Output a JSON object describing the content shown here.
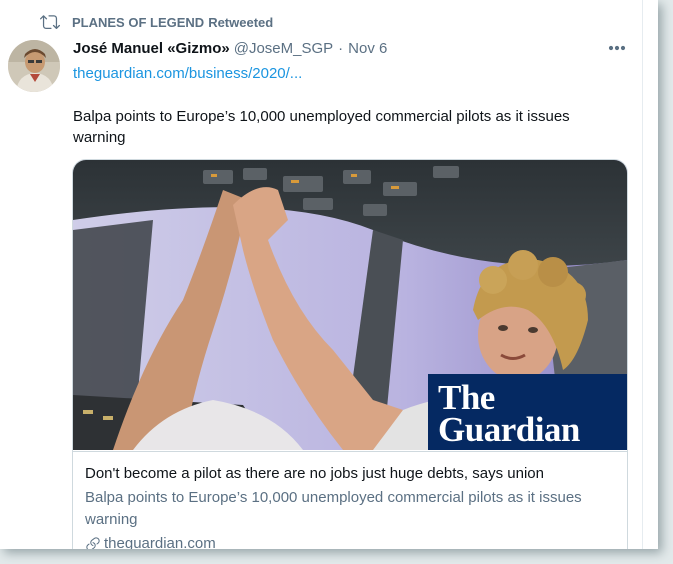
{
  "retweet": {
    "account": "PLANES OF LEGEND",
    "label": "Retweeted",
    "icon": "retweet-icon"
  },
  "tweet": {
    "display_name": "José Manuel «Gizmo»",
    "handle": "@JoseM_SGP",
    "separator": "·",
    "date": "Nov 6",
    "link_text": "theguardian.com/business/2020/...",
    "text": "Balpa points to Europe’s 10,000 unemployed commercial pilots as it issues warning",
    "more_icon": "more-icon"
  },
  "card": {
    "title": "Don't become a pilot as there are no jobs just huge debts, says union",
    "description": "Balpa points to Europe’s 10,000 unemployed commercial pilots as it issues warning",
    "domain": "theguardian.com",
    "logo_line1": "The",
    "logo_line2": "Guardian",
    "domain_icon": "link-icon"
  },
  "colors": {
    "accent": "#1b95e0",
    "secondary_text": "#5b7083",
    "guardian_blue": "#052962"
  }
}
